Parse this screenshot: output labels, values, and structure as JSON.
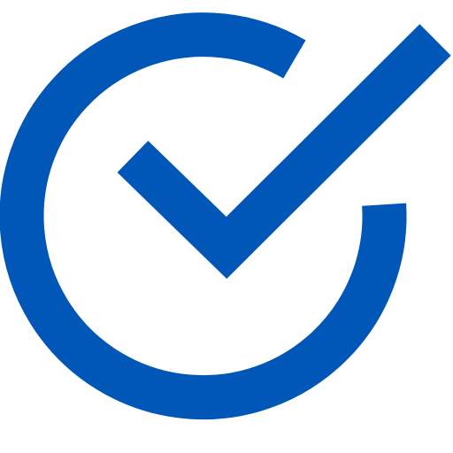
{
  "icon": {
    "name": "check-circle-icon",
    "color": "#0057B8",
    "background": "#FFFFFF"
  }
}
